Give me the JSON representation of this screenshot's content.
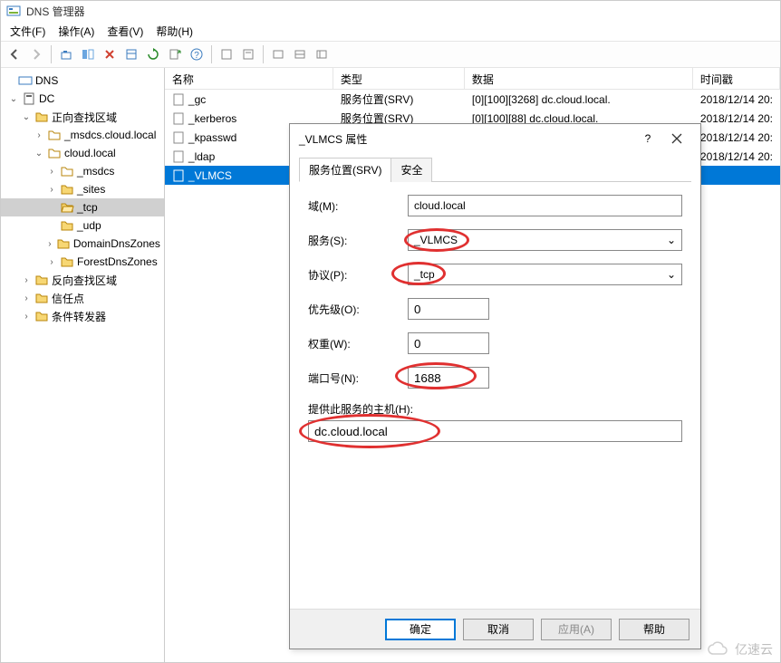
{
  "window": {
    "title": "DNS 管理器"
  },
  "menu": {
    "file": "文件(F)",
    "action": "操作(A)",
    "view": "查看(V)",
    "help": "帮助(H)"
  },
  "tree": {
    "root": "DNS",
    "dc": "DC",
    "fwd": "正向查找区域",
    "msdcs_root": "_msdcs.cloud.local",
    "cloud": "cloud.local",
    "msdcs": "_msdcs",
    "sites": "_sites",
    "tcp": "_tcp",
    "udp": "_udp",
    "ddz": "DomainDnsZones",
    "fdz": "ForestDnsZones",
    "rev": "反向查找区域",
    "trust": "信任点",
    "cond": "条件转发器"
  },
  "list": {
    "cols": {
      "name": "名称",
      "type": "类型",
      "data": "数据",
      "ts": "时间戳"
    },
    "rows": [
      {
        "name": "_gc",
        "type": "服务位置(SRV)",
        "data": "[0][100][3268] dc.cloud.local.",
        "ts": "2018/12/14 20:"
      },
      {
        "name": "_kerberos",
        "type": "服务位置(SRV)",
        "data": "[0][100][88] dc.cloud.local.",
        "ts": "2018/12/14 20:"
      },
      {
        "name": "_kpasswd",
        "type": "",
        "data": "",
        "ts": "2018/12/14 20:"
      },
      {
        "name": "_ldap",
        "type": "",
        "data": "",
        "ts": "2018/12/14 20:"
      },
      {
        "name": "_VLMCS",
        "type": "",
        "data": "",
        "ts": ""
      }
    ]
  },
  "dialog": {
    "title": "_VLMCS 属性",
    "tabs": {
      "srv": "服务位置(SRV)",
      "sec": "安全"
    },
    "labels": {
      "domain": "域(M):",
      "service": "服务(S):",
      "protocol": "协议(P):",
      "priority": "优先级(O):",
      "weight": "权重(W):",
      "port": "端口号(N):",
      "host": "提供此服务的主机(H):"
    },
    "values": {
      "domain": "cloud.local",
      "service": "_VLMCS",
      "protocol": "_tcp",
      "priority": "0",
      "weight": "0",
      "port": "1688",
      "host": "dc.cloud.local"
    },
    "buttons": {
      "ok": "确定",
      "cancel": "取消",
      "apply": "应用(A)",
      "help": "帮助"
    }
  },
  "watermark": "亿速云"
}
